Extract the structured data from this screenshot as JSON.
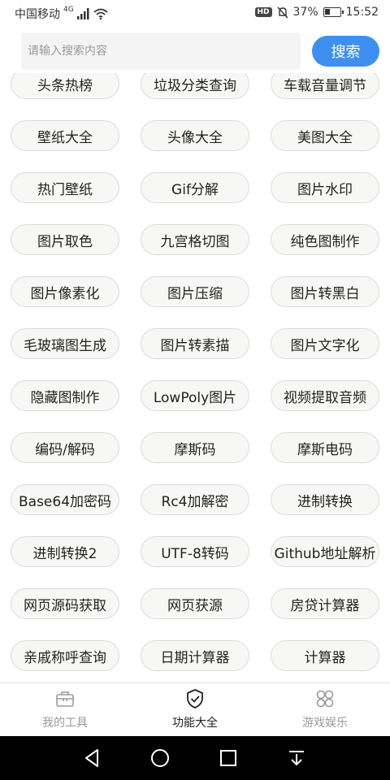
{
  "status_bar": {
    "carrier": "中国移动",
    "network": "4G",
    "hd": "HD",
    "battery_percent": "37%",
    "battery_level": 0.37,
    "time": "15:52"
  },
  "search": {
    "placeholder": "请输入搜索内容",
    "value": "",
    "button_label": "搜索"
  },
  "features": [
    [
      "头条热榜",
      "垃圾分类查询",
      "车载音量调节"
    ],
    [
      "壁纸大全",
      "头像大全",
      "美图大全"
    ],
    [
      "热门壁纸",
      "Gif分解",
      "图片水印"
    ],
    [
      "图片取色",
      "九宫格切图",
      "纯色图制作"
    ],
    [
      "图片像素化",
      "图片压缩",
      "图片转黑白"
    ],
    [
      "毛玻璃图生成",
      "图片转素描",
      "图片文字化"
    ],
    [
      "隐藏图制作",
      "LowPoly图片",
      "视频提取音频"
    ],
    [
      "编码/解码",
      "摩斯码",
      "摩斯电码"
    ],
    [
      "Base64加密码",
      "Rc4加解密",
      "进制转换"
    ],
    [
      "进制转换2",
      "UTF-8转码",
      "Github地址解析"
    ],
    [
      "网页源码获取",
      "网页获源",
      "房贷计算器"
    ],
    [
      "亲戚称呼查询",
      "日期计算器",
      "计算器"
    ]
  ],
  "bottom_nav": {
    "items": [
      {
        "label": "我的工具",
        "icon": "briefcase-icon",
        "active": false
      },
      {
        "label": "功能大全",
        "icon": "shield-check-icon",
        "active": true
      },
      {
        "label": "游戏娱乐",
        "icon": "grid-circles-icon",
        "active": false
      }
    ]
  },
  "colors": {
    "accent": "#3e90f0",
    "pill_bg": "#f7f7f5",
    "pill_border": "#dadada",
    "inactive_nav": "#9a9a9a"
  }
}
